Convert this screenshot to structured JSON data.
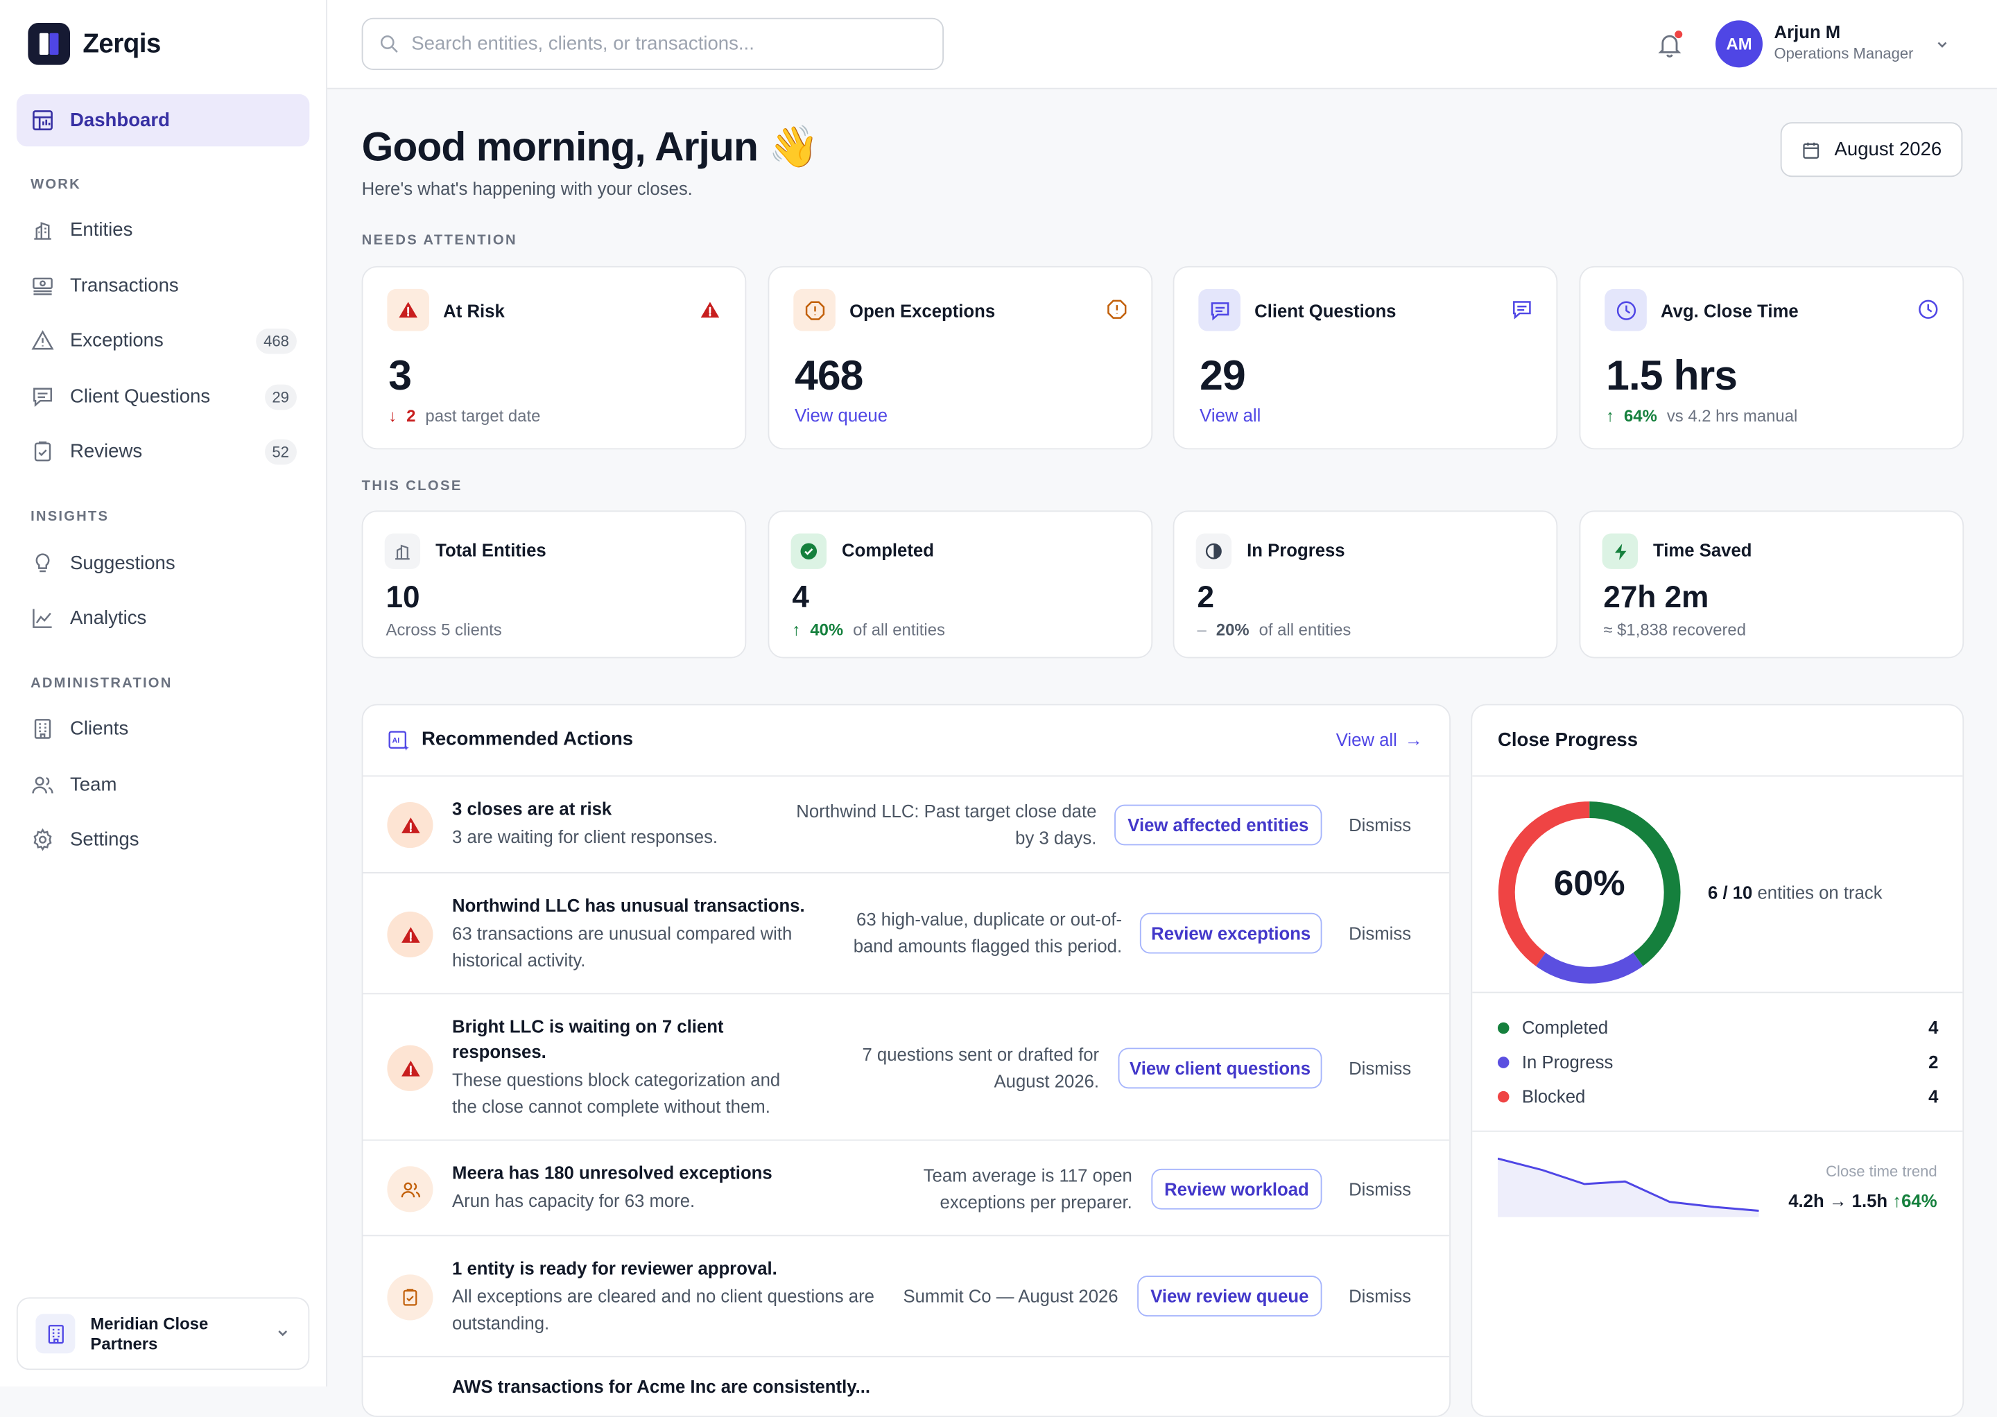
{
  "app": {
    "name": "Zerqis"
  },
  "sidebar": {
    "active": {
      "label": "Dashboard"
    },
    "sections": {
      "work": "WORK",
      "insights": "INSIGHTS",
      "admin": "ADMINISTRATION"
    },
    "items": {
      "entities": {
        "label": "Entities"
      },
      "transactions": {
        "label": "Transactions"
      },
      "exceptions": {
        "label": "Exceptions",
        "badge": "468"
      },
      "client_questions": {
        "label": "Client Questions",
        "badge": "29"
      },
      "reviews": {
        "label": "Reviews",
        "badge": "52"
      },
      "suggestions": {
        "label": "Suggestions"
      },
      "analytics": {
        "label": "Analytics"
      },
      "clients": {
        "label": "Clients"
      },
      "team": {
        "label": "Team"
      },
      "settings": {
        "label": "Settings"
      }
    },
    "org": {
      "name": "Meridian Close Partners"
    }
  },
  "topbar": {
    "search_placeholder": "Search entities, clients, or transactions...",
    "user": {
      "initials": "AM",
      "name": "Arjun M",
      "role": "Operations Manager"
    }
  },
  "header": {
    "greeting": "Good morning, Arjun",
    "emoji": "👋",
    "subtitle": "Here's what's happening with your closes.",
    "period": "August 2026"
  },
  "needs_attention": {
    "label": "NEEDS ATTENTION",
    "at_risk": {
      "title": "At Risk",
      "value": "3",
      "delta": "2",
      "delta_text": "past target date"
    },
    "open_exceptions": {
      "title": "Open Exceptions",
      "value": "468",
      "link": "View queue"
    },
    "client_questions": {
      "title": "Client Questions",
      "value": "29",
      "link": "View all"
    },
    "avg_close": {
      "title": "Avg. Close Time",
      "value": "1.5 hrs",
      "delta": "64%",
      "delta_text": "vs 4.2 hrs manual"
    }
  },
  "this_close": {
    "label": "THIS CLOSE",
    "total": {
      "title": "Total Entities",
      "value": "10",
      "sub": "Across 5 clients"
    },
    "completed": {
      "title": "Completed",
      "value": "4",
      "pct": "40%",
      "sub": "of all entities"
    },
    "in_progress": {
      "title": "In Progress",
      "value": "2",
      "pct": "20%",
      "sub": "of all entities"
    },
    "time_saved": {
      "title": "Time Saved",
      "value": "27h 2m",
      "sub": "≈ $1,838 recovered"
    }
  },
  "recommended": {
    "title": "Recommended Actions",
    "view_all": "View all",
    "dismiss": "Dismiss",
    "items": [
      {
        "title": "3 closes are at risk",
        "desc": "3 are waiting for client responses.",
        "note": "Northwind LLC: Past target close date by 3 days.",
        "action": "View affected entities"
      },
      {
        "title": "Northwind LLC has unusual transactions.",
        "desc": "63 transactions are unusual compared with historical activity.",
        "note": "63 high-value, duplicate or out-of-band amounts flagged this period.",
        "action": "Review exceptions"
      },
      {
        "title": "Bright LLC is waiting on 7 client responses.",
        "desc": "These questions block categorization and the close cannot complete without them.",
        "note": "7 questions sent or drafted for August 2026.",
        "action": "View client questions"
      },
      {
        "title": "Meera has 180 unresolved exceptions",
        "desc": "Arun has capacity for 63 more.",
        "note": "Team average is 117 open exceptions per preparer.",
        "action": "Review workload"
      },
      {
        "title": "1 entity is ready for reviewer approval.",
        "desc": "All exceptions are cleared and no client questions are outstanding.",
        "note": "Summit Co — August 2026",
        "action": "View review queue"
      },
      {
        "title": "AWS transactions for Acme Inc are consistently..."
      }
    ]
  },
  "close_progress": {
    "title": "Close Progress",
    "percent_label": "60%",
    "on_track": "6 / 10",
    "on_track_text": "entities on track",
    "legend": [
      {
        "label": "Completed",
        "value": "4",
        "color": "#15803d"
      },
      {
        "label": "In Progress",
        "value": "2",
        "color": "#5b4fe0"
      },
      {
        "label": "Blocked",
        "value": "4",
        "color": "#ef4444"
      }
    ],
    "trend_label": "Close time trend",
    "trend_from": "4.2h → 1.5h",
    "trend_delta": "↑64%"
  },
  "chart_data": {
    "type": "pie",
    "categories": [
      "Completed",
      "In Progress",
      "Blocked"
    ],
    "values": [
      4,
      2,
      4
    ],
    "colors": [
      "#15803d",
      "#5b4fe0",
      "#ef4444"
    ]
  }
}
